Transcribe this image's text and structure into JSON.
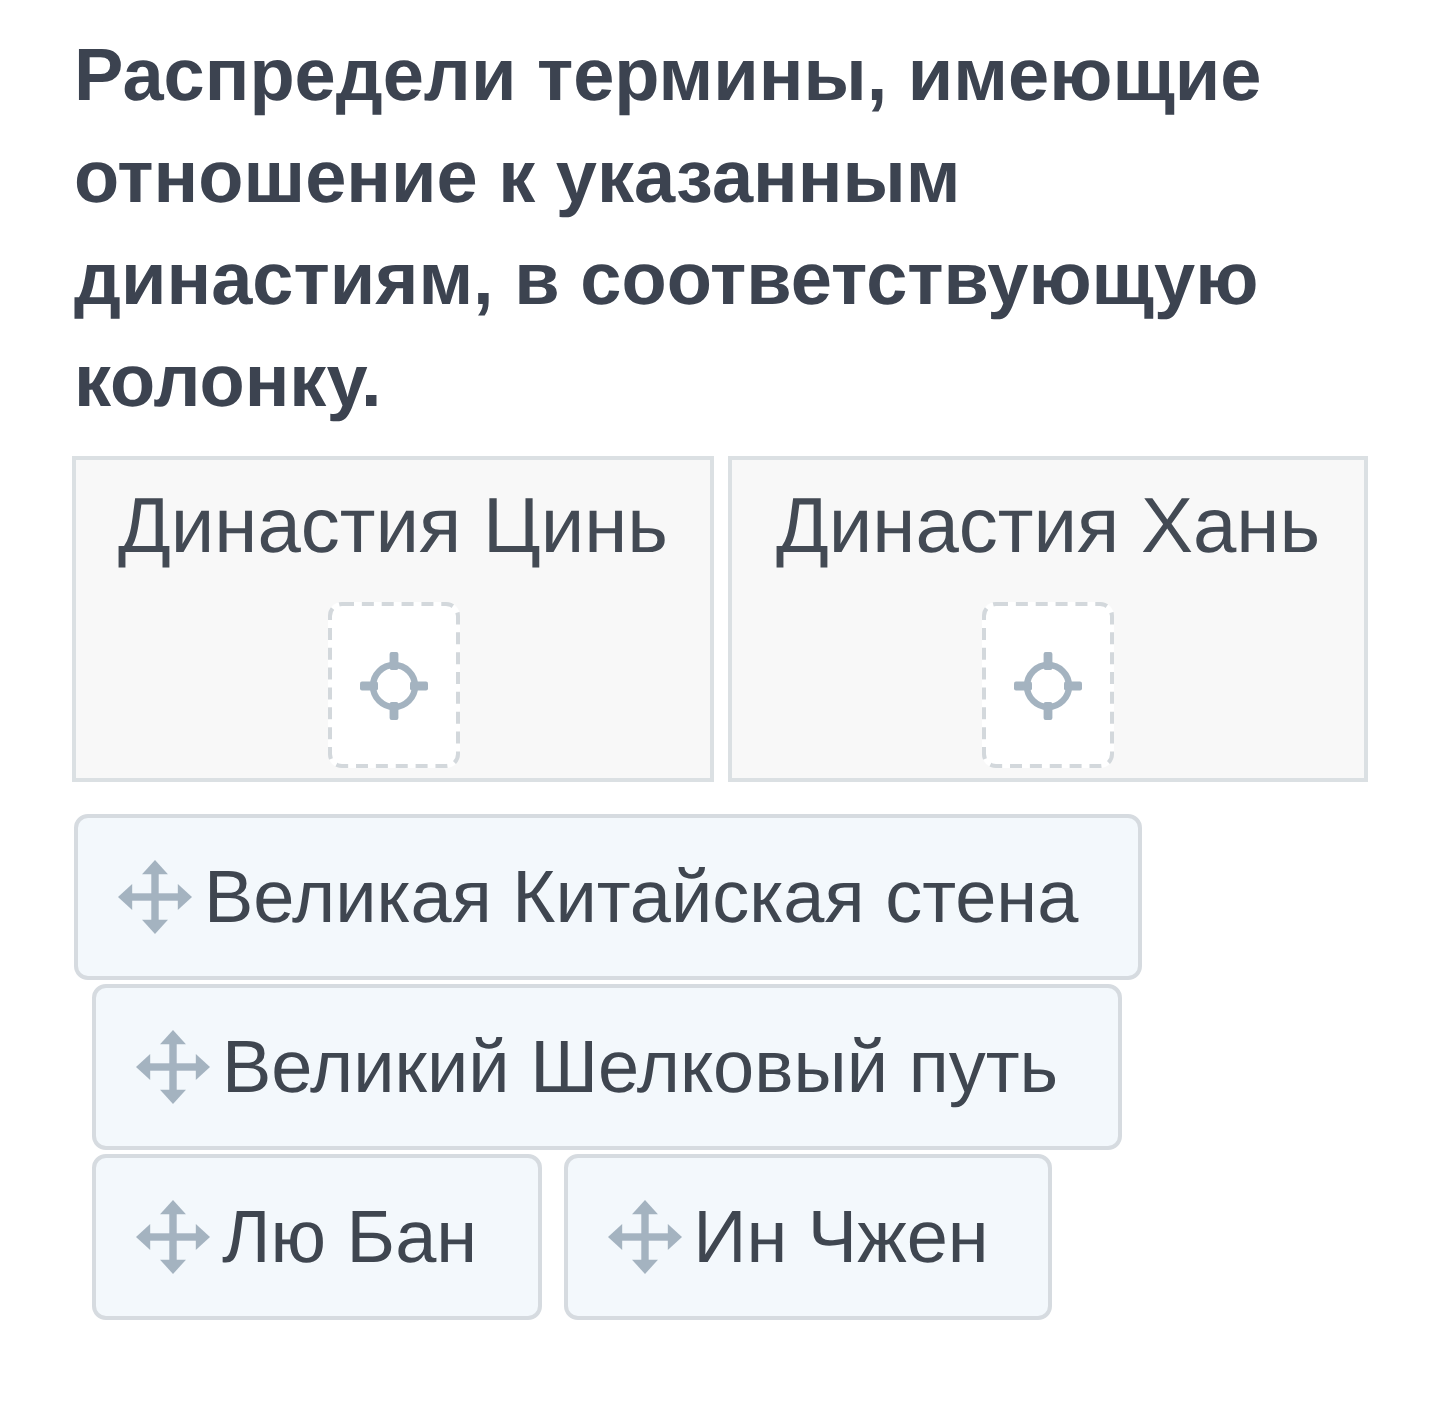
{
  "instruction": "Распредели термины, имеющие отношение к указанным династиям, в соответствующую колонку.",
  "columns": [
    {
      "heading": "Династия Цинь"
    },
    {
      "heading": "Династия Хань"
    }
  ],
  "terms": [
    {
      "label": "Великая Китайская стена"
    },
    {
      "label": "Великий Шелковый путь"
    },
    {
      "label": "Лю Бан"
    },
    {
      "label": "Ин Чжен"
    }
  ]
}
